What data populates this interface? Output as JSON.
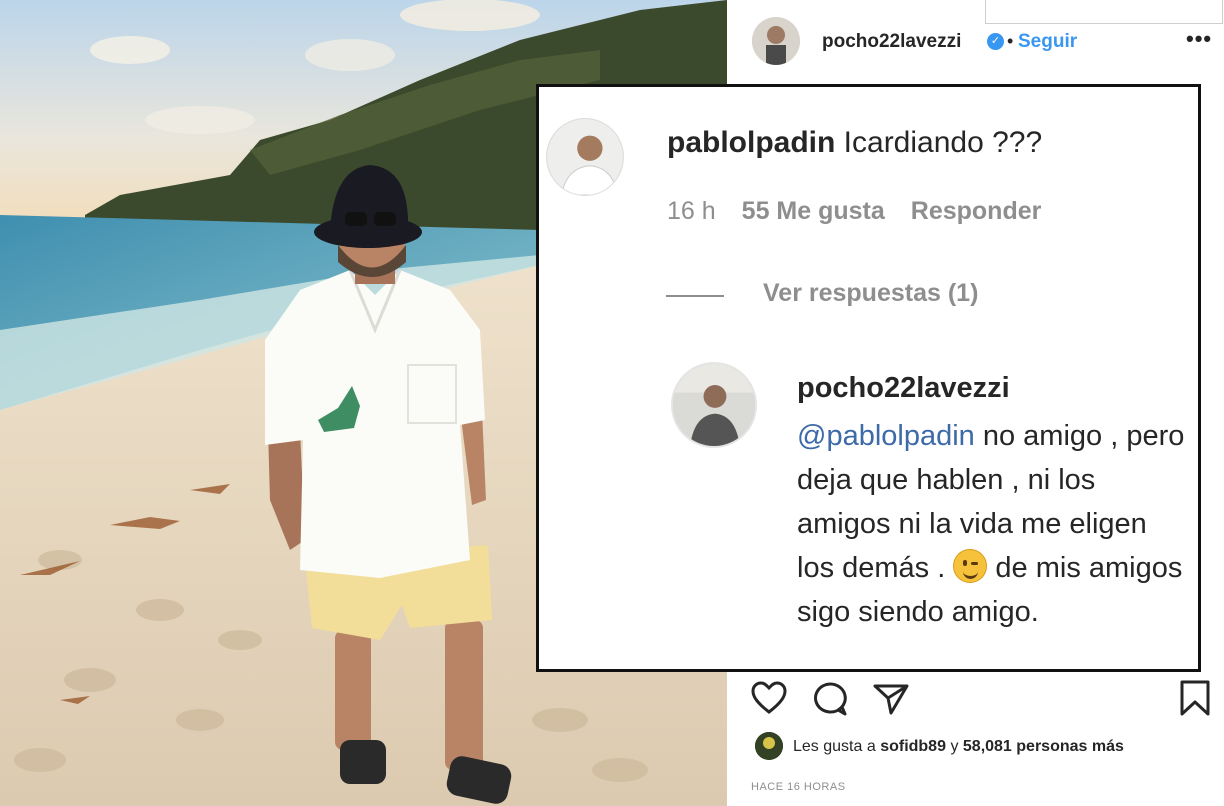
{
  "post": {
    "author": "pocho22lavezzi",
    "separator": "•",
    "follow_label": "Seguir",
    "more_label": "•••",
    "verified_glyph": "✓",
    "likes_prefix": "Les gusta a",
    "likes_user": "sofidb89",
    "likes_conjunction": "y",
    "likes_count": "58,081 personas más",
    "time_ago": "HACE 16 HORAS"
  },
  "comments": {
    "first": {
      "username": "pablolpadin",
      "text": "Icardiando ???",
      "time": "16 h",
      "likes": "55 Me gusta",
      "reply_label": "Responder"
    },
    "view_replies": "Ver respuestas (1)",
    "reply": {
      "username": "pocho22lavezzi",
      "mention": "@pablolpadin",
      "text_part1": " no amigo , pero deja que hablen , ni los amigos ni la vida me eligen los demás .",
      "text_part2": " de mis amigos sigo siendo amigo."
    }
  },
  "icons": [
    "heart-icon",
    "comment-icon",
    "share-icon",
    "bookmark-icon",
    "verified-icon",
    "wink-emoji-icon"
  ],
  "colors": {
    "accent_blue": "#3897f0",
    "mention_blue": "#3d6aa8",
    "muted": "#8e8e8e"
  }
}
